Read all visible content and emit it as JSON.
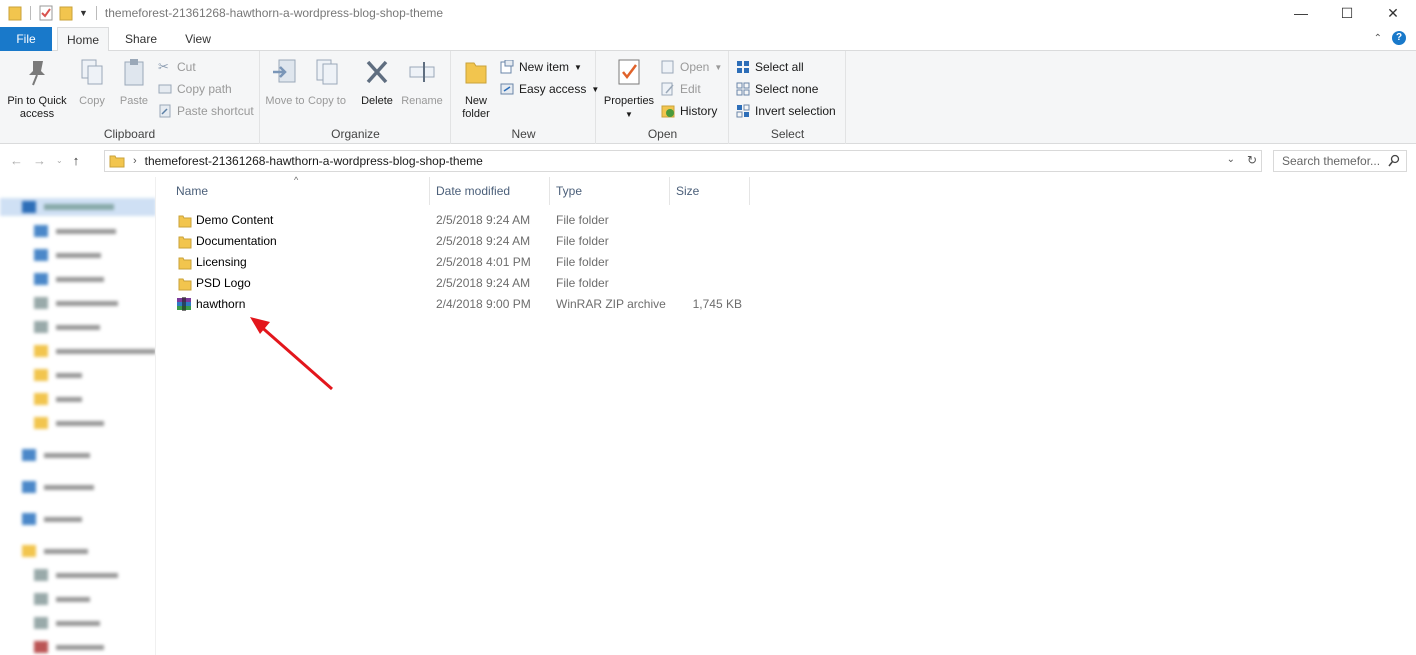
{
  "window": {
    "title": "themeforest-21361268-hawthorn-a-wordpress-blog-shop-theme",
    "controls": {
      "minimize": "—",
      "maximize": "☐",
      "close": "✕"
    }
  },
  "tabs": [
    {
      "label": "File"
    },
    {
      "label": "Home"
    },
    {
      "label": "Share"
    },
    {
      "label": "View"
    }
  ],
  "ribbon": {
    "clipboard": {
      "label": "Clipboard",
      "pin_label": "Pin to Quick access",
      "copy_label": "Copy",
      "paste_label": "Paste",
      "cut_label": "Cut",
      "copy_path_label": "Copy path",
      "paste_shortcut_label": "Paste shortcut"
    },
    "organize": {
      "label": "Organize",
      "move_to_label": "Move to",
      "copy_to_label": "Copy to",
      "delete_label": "Delete",
      "rename_label": "Rename"
    },
    "new": {
      "label": "New",
      "new_folder_label": "New folder",
      "new_item_label": "New item",
      "easy_access_label": "Easy access"
    },
    "open": {
      "label": "Open",
      "properties_label": "Properties",
      "open_label": "Open",
      "edit_label": "Edit",
      "history_label": "History"
    },
    "select": {
      "label": "Select",
      "select_all_label": "Select all",
      "select_none_label": "Select none",
      "invert_label": "Invert selection"
    }
  },
  "address": {
    "path": "themeforest-21361268-hawthorn-a-wordpress-blog-shop-theme",
    "search_placeholder": "Search themefor..."
  },
  "columns": {
    "name": "Name",
    "date": "Date modified",
    "type": "Type",
    "size": "Size"
  },
  "files": [
    {
      "name": "Demo Content",
      "date": "2/5/2018 9:24 AM",
      "type": "File folder",
      "size": "",
      "icon": "folder-icon"
    },
    {
      "name": "Documentation",
      "date": "2/5/2018 9:24 AM",
      "type": "File folder",
      "size": "",
      "icon": "folder-icon"
    },
    {
      "name": "Licensing",
      "date": "2/5/2018 4:01 PM",
      "type": "File folder",
      "size": "",
      "icon": "folder-icon"
    },
    {
      "name": "PSD Logo",
      "date": "2/5/2018 9:24 AM",
      "type": "File folder",
      "size": "",
      "icon": "folder-icon"
    },
    {
      "name": "hawthorn",
      "date": "2/4/2018 9:00 PM",
      "type": "WinRAR ZIP archive",
      "size": "1,745 KB",
      "icon": "winrar-icon"
    }
  ],
  "colors": {
    "accent": "#1979ca",
    "folder": "#f2c54e",
    "arrow": "#e3161c"
  }
}
